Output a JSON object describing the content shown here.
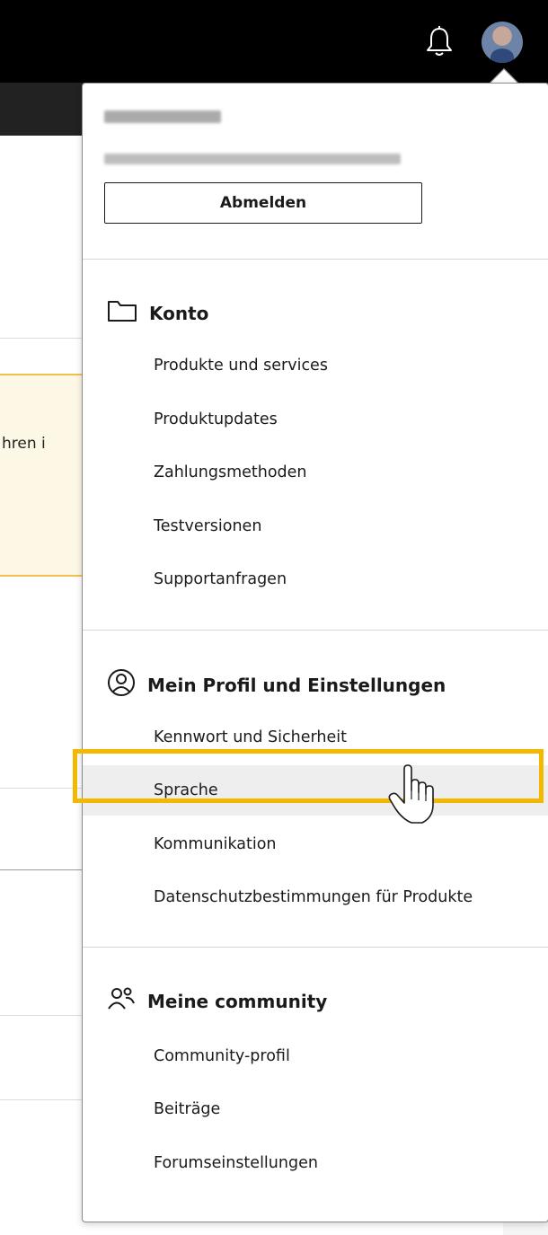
{
  "header": {
    "bell_icon": "bell-icon",
    "avatar_icon": "user-avatar"
  },
  "background": {
    "banner_text": "hren i"
  },
  "account_menu": {
    "signout_label": "Abmelden",
    "sections": [
      {
        "title": "Konto",
        "icon": "folder-icon",
        "items": [
          "Produkte und services",
          "Produktupdates",
          "Zahlungsmethoden",
          "Testversionen",
          "Supportanfragen"
        ]
      },
      {
        "title": "Mein Profil und Einstellungen",
        "icon": "user-circle-icon",
        "items": [
          "Kennwort und Sicherheit",
          "Sprache",
          "Kommunikation",
          "Datenschutzbestimmungen für Produkte"
        ]
      },
      {
        "title": "Meine community",
        "icon": "people-icon",
        "items": [
          "Community-profil",
          "Beiträge",
          "Forumseinstellungen"
        ]
      }
    ],
    "hovered_item": "Sprache",
    "highlight_color": "#f5b800"
  }
}
